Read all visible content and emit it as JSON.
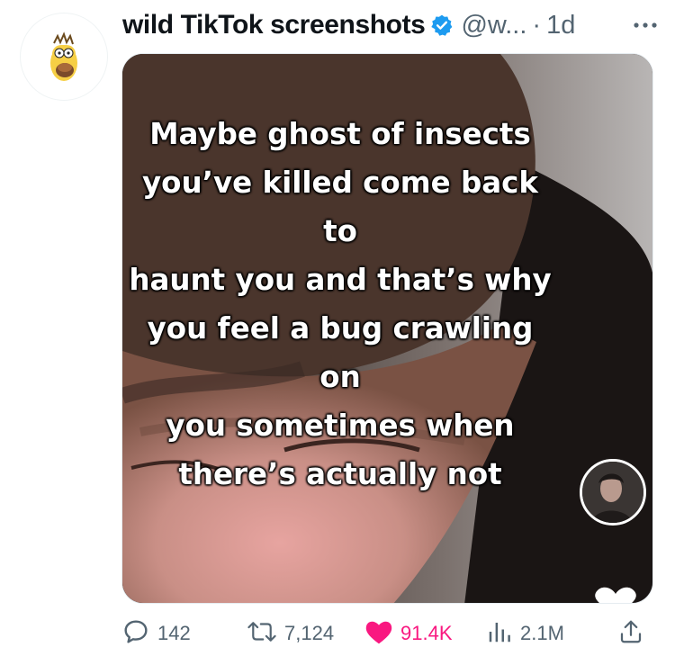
{
  "tweet": {
    "author_name": "wild TikTok screenshots",
    "handle": "@w...",
    "separator": "·",
    "time": "1d",
    "caption": "Maybe ghost of insects\nyou’ve killed come back to\nhaunt you and that’s why\nyou feel a bug crawling on\nyou sometimes when\nthere’s actually not",
    "accent_color": "#1d9bf0",
    "like_color": "#f91880"
  },
  "actions": {
    "replies": "142",
    "retweets": "7,124",
    "likes": "91.4K",
    "views": "2.1M"
  },
  "icons": [
    "avatar-cartoon",
    "verified-badge-icon",
    "more-options-icon",
    "reply-icon",
    "retweet-icon",
    "like-icon",
    "views-icon",
    "share-icon"
  ]
}
